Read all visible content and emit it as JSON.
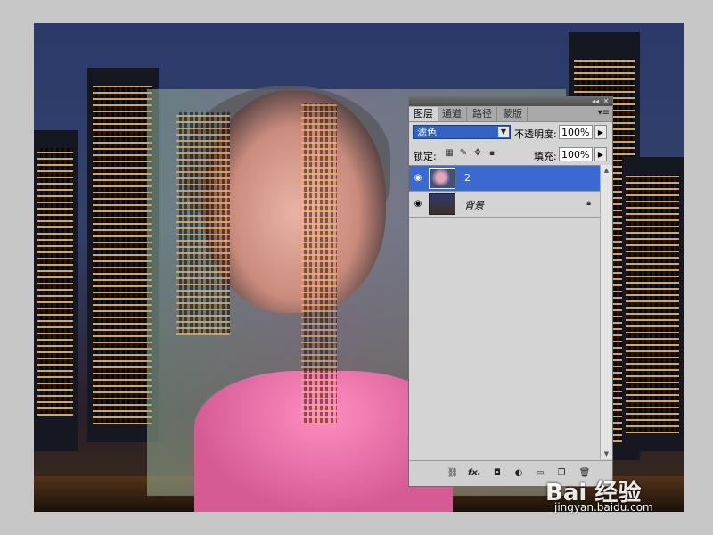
{
  "panel": {
    "tabs": [
      "图层",
      "通道",
      "路径",
      "蒙版"
    ],
    "menu_icon": "panel-menu-icon",
    "blend_mode": "滤色",
    "opacity_label": "不透明度:",
    "opacity_value": "100%",
    "lock_label": "锁定:",
    "fill_label": "填充:",
    "fill_value": "100%",
    "layers": [
      {
        "name": "2",
        "selected": true,
        "visible": true
      },
      {
        "name": "背景",
        "selected": false,
        "visible": true,
        "locked": true
      }
    ],
    "bottom_icons": [
      "link-icon",
      "fx-icon",
      "mask-icon",
      "adjustment-icon",
      "group-icon",
      "new-layer-icon",
      "trash-icon"
    ],
    "fx_label": "fx."
  },
  "watermark": {
    "logo": "Bai 经验",
    "url": "jingyan.baidu.com"
  },
  "colors": {
    "selection": "#3a6ad0",
    "blend_select": "#3163c5",
    "shirt": "#ff8ec1"
  }
}
